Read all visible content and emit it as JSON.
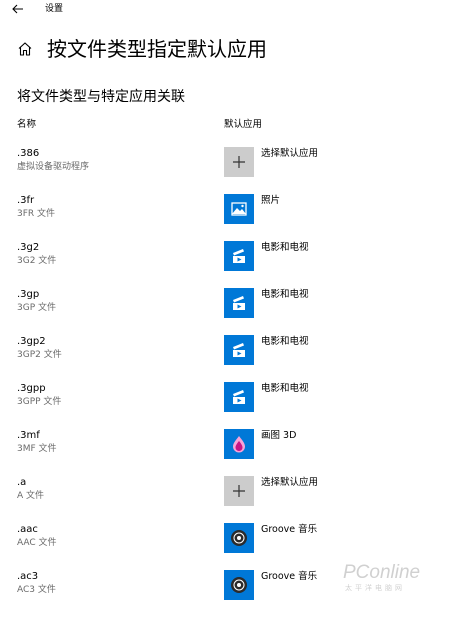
{
  "header": {
    "app_title": "设置",
    "back_icon": "back-arrow-icon"
  },
  "page": {
    "title": "按文件类型指定默认应用",
    "home_icon": "home-icon",
    "section_title": "将文件类型与特定应用关联"
  },
  "columns": {
    "name": "名称",
    "app": "默认应用"
  },
  "rows": [
    {
      "ext": ".386",
      "desc": "虚拟设备驱动程序",
      "app": "选择默认应用",
      "icon": "plus-icon"
    },
    {
      "ext": ".3fr",
      "desc": "3FR 文件",
      "app": "照片",
      "icon": "photos-icon"
    },
    {
      "ext": ".3g2",
      "desc": "3G2 文件",
      "app": "电影和电视",
      "icon": "movies-tv-icon"
    },
    {
      "ext": ".3gp",
      "desc": "3GP 文件",
      "app": "电影和电视",
      "icon": "movies-tv-icon"
    },
    {
      "ext": ".3gp2",
      "desc": "3GP2 文件",
      "app": "电影和电视",
      "icon": "movies-tv-icon"
    },
    {
      "ext": ".3gpp",
      "desc": "3GPP 文件",
      "app": "电影和电视",
      "icon": "movies-tv-icon"
    },
    {
      "ext": ".3mf",
      "desc": "3MF 文件",
      "app": "画图 3D",
      "icon": "paint-3d-icon"
    },
    {
      "ext": ".a",
      "desc": "A 文件",
      "app": "选择默认应用",
      "icon": "plus-icon"
    },
    {
      "ext": ".aac",
      "desc": "AAC 文件",
      "app": "Groove 音乐",
      "icon": "groove-music-icon"
    },
    {
      "ext": ".ac3",
      "desc": "AC3 文件",
      "app": "Groove 音乐",
      "icon": "groove-music-icon"
    }
  ],
  "watermark": {
    "main": "PConline",
    "sub": "太平洋电脑网"
  },
  "colors": {
    "accent": "#0078d7",
    "plus_tile": "#cccccc",
    "secondary_text": "#6b6b6b"
  }
}
